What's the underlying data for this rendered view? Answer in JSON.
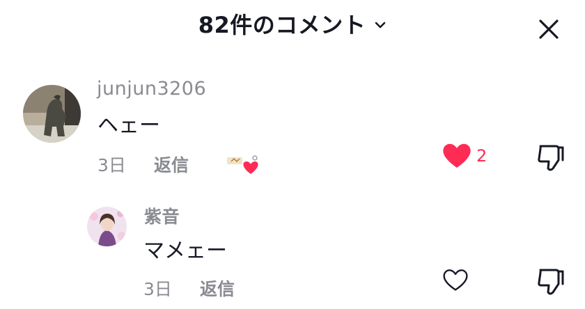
{
  "header": {
    "title": "82件のコメント",
    "chevron_icon": "chevron-down-icon",
    "close_icon": "close-icon"
  },
  "comments": [
    {
      "username": "junjun3206",
      "text": "ヘェー",
      "date": "3日",
      "reply_label": "返信",
      "liked": true,
      "like_count": "2",
      "creator_liked_badge": true
    }
  ],
  "replies": [
    {
      "username": "紫音",
      "text": "マメェー",
      "date": "3日",
      "reply_label": "返信",
      "liked": false
    }
  ],
  "colors": {
    "accent_like": "#fe2c55",
    "text_primary": "#161823",
    "text_secondary": "#8a8b91"
  }
}
